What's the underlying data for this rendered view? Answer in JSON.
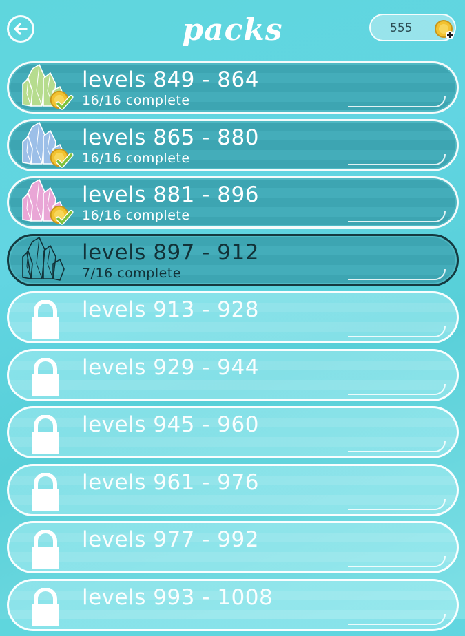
{
  "header": {
    "title": "packs",
    "coins": "555"
  },
  "packs": [
    {
      "title": "levels 849 - 864",
      "status": "16/16 complete",
      "state": "done",
      "crystal_color": "#b6dc8e"
    },
    {
      "title": "levels 865 - 880",
      "status": "16/16 complete",
      "state": "done",
      "crystal_color": "#9cbfe8"
    },
    {
      "title": "levels 881 - 896",
      "status": "16/16 complete",
      "state": "done",
      "crystal_color": "#e9a6d6"
    },
    {
      "title": "levels 897 - 912",
      "status": "7/16 complete",
      "state": "current",
      "crystal_color": "none"
    },
    {
      "title": "levels 913 - 928",
      "status": "",
      "state": "locked"
    },
    {
      "title": "levels 929 - 944",
      "status": "",
      "state": "locked"
    },
    {
      "title": "levels 945 - 960",
      "status": "",
      "state": "locked"
    },
    {
      "title": "levels 961 - 976",
      "status": "",
      "state": "locked"
    },
    {
      "title": "levels 977 - 992",
      "status": "",
      "state": "locked"
    },
    {
      "title": "levels 993 - 1008",
      "status": "",
      "state": "locked"
    }
  ],
  "colors": {
    "background": "#5fd6dd",
    "unlocked_row": "#3da5b2",
    "coin": "#f2c230",
    "check": "#7ec13b"
  },
  "icons": [
    "back-arrow-icon",
    "coin-plus-icon",
    "crystal-icon",
    "coin-check-icon",
    "lock-icon"
  ]
}
